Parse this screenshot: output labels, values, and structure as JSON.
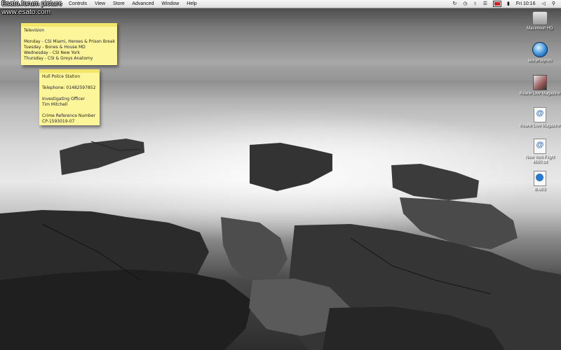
{
  "watermark": {
    "line1": "Esato.forum picture",
    "line2": "www.esato.com"
  },
  "menubar": {
    "menus": [
      "Controls",
      "View",
      "Store",
      "Advanced",
      "Window",
      "Help"
    ],
    "clock": "Fri 10:16"
  },
  "stickies": [
    {
      "lines": [
        "Television",
        "",
        "Monday - CSI Miami, Heroes & Prison Break",
        "Tuesday - Bones & House MD",
        "Wednesday - CSI New York",
        "Thursday - CSI & Greys Anatomy"
      ]
    },
    {
      "lines": [
        "Hull Police Station",
        "",
        "Telephone: 01482597852",
        "",
        "Investigating Officer",
        "Tim Mitchell",
        "",
        "Crime Reference Number",
        "CP-1593019-07"
      ]
    }
  ],
  "desktop_icons": [
    {
      "label": "Macintosh HD",
      "icon": "hard-drive-icon"
    },
    {
      "label": "lauramaynes",
      "icon": "globe-icon"
    },
    {
      "label": "Keane Live Magazine",
      "icon": "photo-file-icon"
    },
    {
      "label": "Keane Live Magazine",
      "icon": "internet-location-icon"
    },
    {
      "label": "New York Flight 4690.txt",
      "icon": "internet-location-icon"
    },
    {
      "label": "lb.u03",
      "icon": "quicktime-file-icon"
    }
  ]
}
